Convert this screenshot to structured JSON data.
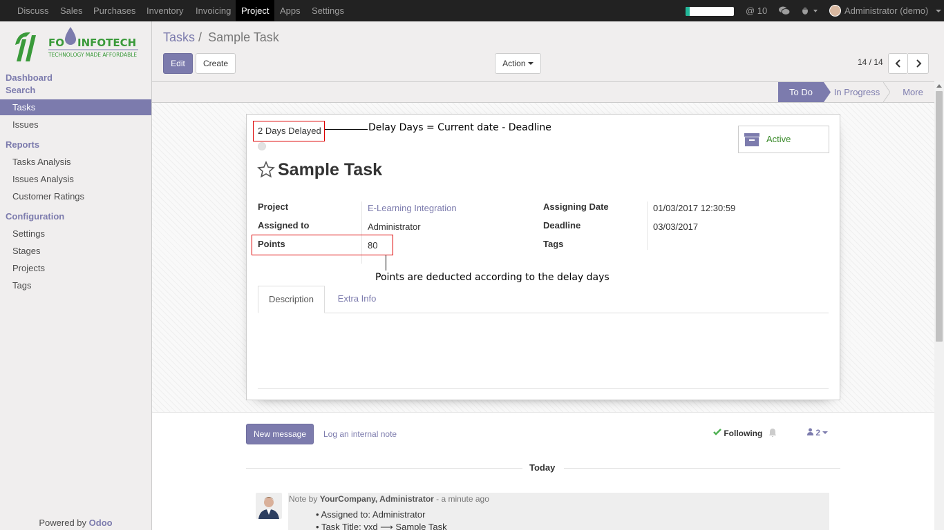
{
  "topbar": {
    "menus": [
      "Discuss",
      "Sales",
      "Purchases",
      "Inventory",
      "Invoicing",
      "Project",
      "Apps",
      "Settings"
    ],
    "active_menu": "Project",
    "progress": 0.08,
    "mentions": "@ 10",
    "user": "Administrator (demo)"
  },
  "sidebar": {
    "logo_brand_left": "FO",
    "logo_brand_right": "INFOTECH",
    "logo_tagline": "TECHNOLOGY MADE AFFORDABLE",
    "dashboard": "Dashboard",
    "search": "Search",
    "tasks": "Tasks",
    "issues": "Issues",
    "reports_header": "Reports",
    "tasks_analysis": "Tasks Analysis",
    "issues_analysis": "Issues Analysis",
    "customer_ratings": "Customer Ratings",
    "config_header": "Configuration",
    "settings": "Settings",
    "stages": "Stages",
    "projects": "Projects",
    "tags": "Tags",
    "powered_by": "Powered by",
    "powered_brand": "Odoo"
  },
  "controlpanel": {
    "breadcrumb_parent": "Tasks",
    "breadcrumb_sep": "/",
    "breadcrumb_current": "Sample Task",
    "edit": "Edit",
    "create": "Create",
    "action": "Action",
    "pager": "14 / 14"
  },
  "stages": [
    "To Do",
    "In Progress",
    "More"
  ],
  "record": {
    "delay": "2 Days Delayed",
    "active": "Active",
    "title": "Sample Task",
    "project_label": "Project",
    "project": "E-Learning Integration",
    "assigned_label": "Assigned to",
    "assigned": "Administrator",
    "points_label": "Points",
    "points": "80",
    "assigning_label": "Assigning Date",
    "assigning": "01/03/2017 12:30:59",
    "deadline_label": "Deadline",
    "deadline": "03/03/2017",
    "tags_label": "Tags",
    "tabs": [
      "Description",
      "Extra Info"
    ]
  },
  "annotations": {
    "delay_note": "Delay Days = Current date - Deadline",
    "points_note": "Points are deducted according to the delay days"
  },
  "chatter": {
    "new_message": "New message",
    "log_note": "Log an internal note",
    "following": "Following",
    "followers": "2",
    "today": "Today",
    "note_prefix": "Note by",
    "note_author": "YourCompany, Administrator",
    "note_time": "- a minute ago",
    "note_line1": "Assigned to: Administrator",
    "note_line2": "Task Title: vxd ⟶ Sample Task"
  }
}
